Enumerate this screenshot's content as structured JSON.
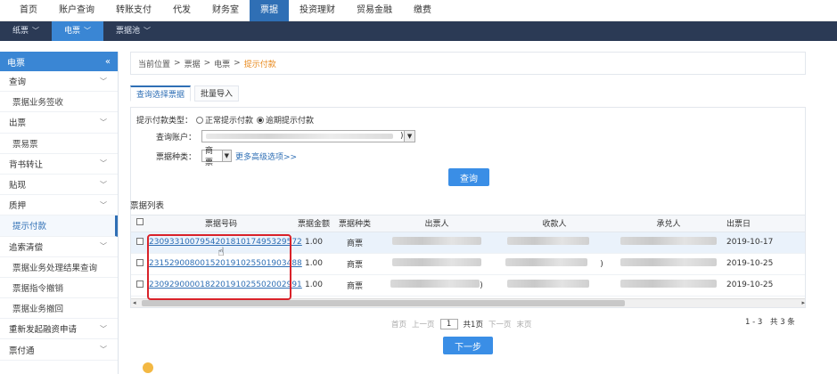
{
  "topnav": [
    "首页",
    "账户查询",
    "转账支付",
    "代发",
    "财务室",
    "票据",
    "投资理财",
    "贸易金融",
    "缴费"
  ],
  "topnav_active": 5,
  "subnav": [
    {
      "label": "纸票",
      "active": false
    },
    {
      "label": "电票",
      "active": true
    },
    {
      "label": "票据池",
      "active": false
    }
  ],
  "sidebar": {
    "title": "电票",
    "collapse_icon": "«",
    "items": [
      {
        "label": "查询",
        "chev": "﹀",
        "sub": false,
        "active": false
      },
      {
        "label": "票据业务签收",
        "chev": "",
        "sub": true,
        "active": false
      },
      {
        "label": "出票",
        "chev": "﹀",
        "sub": false,
        "active": false
      },
      {
        "label": "票易票",
        "chev": "",
        "sub": true,
        "active": false
      },
      {
        "label": "背书转让",
        "chev": "﹀",
        "sub": false,
        "active": false
      },
      {
        "label": "贴现",
        "chev": "﹀",
        "sub": false,
        "active": false
      },
      {
        "label": "质押",
        "chev": "﹀",
        "sub": false,
        "active": false
      },
      {
        "label": "提示付款",
        "chev": "",
        "sub": true,
        "active": true
      },
      {
        "label": "追索清偿",
        "chev": "﹀",
        "sub": false,
        "active": false
      },
      {
        "label": "票据业务处理结果查询",
        "chev": "",
        "sub": true,
        "active": false
      },
      {
        "label": "票据指令撤销",
        "chev": "",
        "sub": true,
        "active": false
      },
      {
        "label": "票据业务撤回",
        "chev": "",
        "sub": true,
        "active": false
      },
      {
        "label": "重新发起融资申请",
        "chev": "﹀",
        "sub": false,
        "active": false
      },
      {
        "label": "票付通",
        "chev": "﹀",
        "sub": false,
        "active": false
      }
    ]
  },
  "breadcrumb": {
    "prefix": "当前位置",
    "sep": ">",
    "path1": "票据",
    "path2": "电票",
    "current": "提示付款"
  },
  "tabs": [
    {
      "label": "查询选择票据",
      "active": true
    },
    {
      "label": "批量导入",
      "active": false
    }
  ],
  "form": {
    "type_label": "提示付款类型：",
    "type_normal": "正常提示付款",
    "type_overdue": "逾期提示付款",
    "account_label": "查询账户：",
    "account_suffix": ")",
    "bill_type_label": "票据种类：",
    "bill_type_value": "商票",
    "more_options": "更多高级选项>>",
    "query_button": "查询"
  },
  "list": {
    "title": "票据列表",
    "columns": [
      "票据号码",
      "票据金额",
      "票据种类",
      "出票人",
      "收款人",
      "承兑人",
      "出票日"
    ],
    "rows": [
      {
        "billno": "230933100795420181017495329572",
        "amount": "1.00",
        "type": "商票",
        "drawer_suffix": "",
        "payee_suffix": "",
        "date": "2019-10-17",
        "highlight": true
      },
      {
        "billno": "231529008001520191025501903488",
        "amount": "1.00",
        "type": "商票",
        "drawer_suffix": "",
        "payee_suffix": ")",
        "date": "2019-10-25",
        "highlight": false
      },
      {
        "billno": "230929000018220191025502002991",
        "amount": "1.00",
        "type": "商票",
        "drawer_suffix": ")",
        "payee_suffix": "",
        "date": "2019-10-25",
        "highlight": false
      }
    ]
  },
  "pager": {
    "first": "首页",
    "prev": "上一页",
    "page": "1",
    "total_pages": "共1页",
    "next": "下一页",
    "last": "末页",
    "range": "1 - 3",
    "count": "共 3 条"
  },
  "next_button": "下一步",
  "colors": {
    "accent": "#3a86d4",
    "nav_dark": "#2b3a55",
    "highlight": "#d9222a",
    "breadcrumb_current": "#e8891c"
  }
}
